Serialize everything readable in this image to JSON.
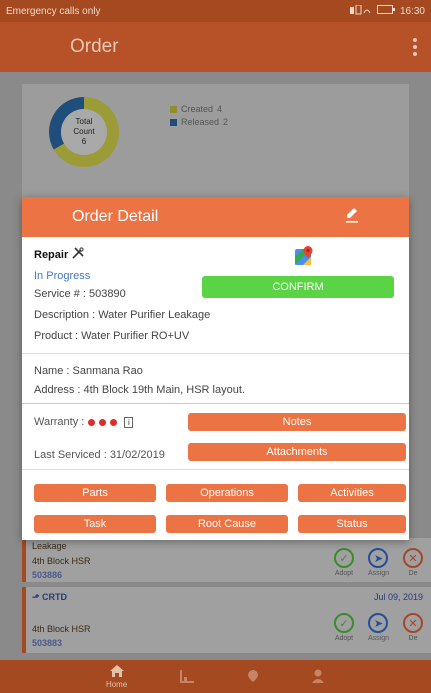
{
  "status_bar": {
    "left": "Emergency calls only",
    "time": "16:30"
  },
  "app_bar": {
    "title": "Order"
  },
  "summary": {
    "donut_label_1": "Total",
    "donut_label_2": "Count",
    "donut_total": "6",
    "legend": [
      {
        "label": "Created",
        "count": "4",
        "color": "#c9c93a"
      },
      {
        "label": "Released",
        "count": "2",
        "color": "#1e5a9a"
      }
    ]
  },
  "modal": {
    "title": "Order Detail",
    "order_type": "Repair",
    "status": "In Progress",
    "service_no": "Service # : 503890",
    "description": "Description : Water Purifier Leakage",
    "product": "Product : Water Purifier RO+UV",
    "confirm_label": "CONFIRM",
    "name": "Name : Sanmana Rao",
    "address": "Address : 4th Block 19th Main, HSR layout.",
    "warranty_label": "Warranty :",
    "last_serviced": "Last Serviced : 31/02/2019",
    "notes_label": "Notes",
    "attachments_label": "Attachments",
    "buttons": {
      "parts": "Parts",
      "operations": "Operations",
      "activities": "Activities",
      "task": "Task",
      "root_cause": "Root Cause",
      "status": "Status"
    }
  },
  "cards": [
    {
      "title": "Leakage",
      "location": "4th Block HSR",
      "id": "503886"
    },
    {
      "tag": "CRTD",
      "date": "Jul 09, 2019",
      "location": "4th Block HSR",
      "id": "503883"
    }
  ],
  "card_actions": {
    "adopt": "Adopt",
    "assign": "Assign",
    "decline": "De"
  },
  "bottom_nav": {
    "home": "Home"
  }
}
